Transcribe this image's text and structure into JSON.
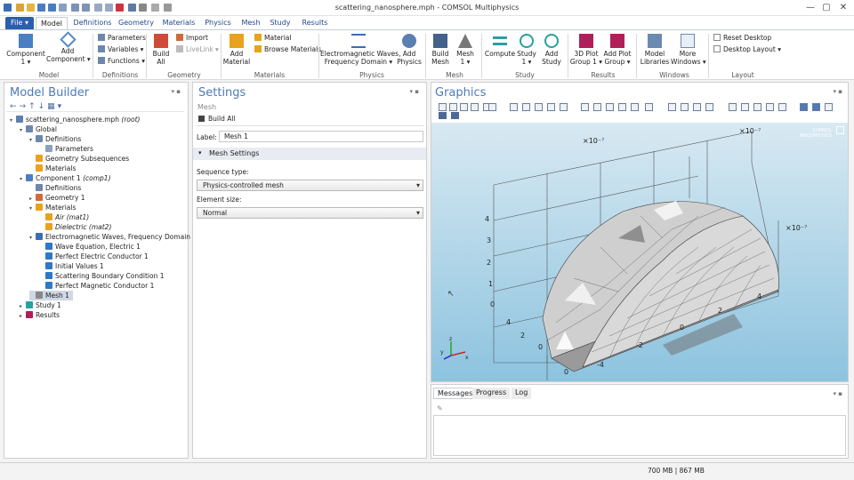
{
  "window": {
    "title": "scattering_nanosphere.mph - COMSOL Multiphysics"
  },
  "tabs": {
    "file": "File ▾",
    "model": "Model",
    "definitions": "Definitions",
    "geometry": "Geometry",
    "materials": "Materials",
    "physics": "Physics",
    "mesh": "Mesh",
    "study": "Study",
    "results": "Results"
  },
  "ribbon": {
    "component": "Component\n1 ▾",
    "add_component": "Add\nComponent ▾",
    "parameters": "Parameters",
    "variables": "Variables ▾",
    "functions": "Functions ▾",
    "build_all": "Build\nAll",
    "import": "Import",
    "livelink": "LiveLink ▾",
    "add_material": "Add\nMaterial",
    "material": "Material",
    "browse_materials": "Browse Materials",
    "em_waves": "Electromagnetic Waves,\nFrequency Domain ▾",
    "add_physics": "Add\nPhysics",
    "build_mesh": "Build\nMesh",
    "mesh1": "Mesh\n1 ▾",
    "compute": "Compute",
    "study1": "Study\n1 ▾",
    "add_study": "Add\nStudy",
    "plot3d": "3D Plot\nGroup 1 ▾",
    "add_plot": "Add Plot\nGroup ▾",
    "model_libraries": "Model\nLibraries",
    "more_windows": "More\nWindows ▾",
    "reset_desktop": "Reset Desktop",
    "desktop_layout": "Desktop Layout ▾",
    "groups": {
      "model": "Model",
      "definitions": "Definitions",
      "geometry": "Geometry",
      "materials": "Materials",
      "physics": "Physics",
      "mesh": "Mesh",
      "study": "Study",
      "results": "Results",
      "windows": "Windows",
      "layout": "Layout"
    }
  },
  "model_builder": {
    "title": "Model Builder",
    "tree": [
      {
        "label": "scattering_nanosphere.mph",
        "suffix": "(root)",
        "depth": 0
      },
      {
        "label": "Global",
        "depth": 1
      },
      {
        "label": "Definitions",
        "depth": 2
      },
      {
        "label": "Parameters",
        "depth": 3
      },
      {
        "label": "Geometry Subsequences",
        "depth": 2
      },
      {
        "label": "Materials",
        "depth": 2
      },
      {
        "label": "Component 1",
        "suffix": "(comp1)",
        "depth": 1
      },
      {
        "label": "Definitions",
        "depth": 2
      },
      {
        "label": "Geometry 1",
        "depth": 2
      },
      {
        "label": "Materials",
        "depth": 2
      },
      {
        "label": "Air",
        "suffix": "(mat1)",
        "depth": 3
      },
      {
        "label": "Dielectric",
        "suffix": "(mat2)",
        "depth": 3
      },
      {
        "label": "Electromagnetic Waves, Frequency Domain",
        "suffix": "(e",
        "depth": 2
      },
      {
        "label": "Wave Equation, Electric 1",
        "depth": 3
      },
      {
        "label": "Perfect Electric Conductor 1",
        "depth": 3
      },
      {
        "label": "Initial Values 1",
        "depth": 3
      },
      {
        "label": "Scattering Boundary Condition 1",
        "depth": 3
      },
      {
        "label": "Perfect Magnetic Conductor 1",
        "depth": 3
      },
      {
        "label": "Mesh 1",
        "depth": 2
      },
      {
        "label": "Study 1",
        "depth": 1
      },
      {
        "label": "Results",
        "depth": 1
      }
    ]
  },
  "settings": {
    "title": "Settings",
    "subtitle": "Mesh",
    "build_all": "Build All",
    "label_caption": "Label:",
    "label_value": "Mesh 1",
    "section": "Mesh Settings",
    "sequence_type_label": "Sequence type:",
    "sequence_type_value": "Physics-controlled mesh",
    "element_size_label": "Element size:",
    "element_size_value": "Normal"
  },
  "graphics": {
    "title": "Graphics",
    "exp_left": "×10⁻⁷",
    "exp_top": "×10⁻⁷",
    "exp_right": "×10⁻⁷",
    "watermark": "COMSOL\nMULTIPHYSICS",
    "z_ticks": [
      "4",
      "3",
      "2",
      "1",
      "0"
    ],
    "x_ticks": [
      "4",
      "2",
      "0"
    ],
    "y_ticks": [
      "4",
      "2",
      "0",
      "-2",
      "-4"
    ],
    "front_ticks": [
      "0"
    ]
  },
  "messages": {
    "tabs": [
      "Messages",
      "Progress",
      "Log"
    ]
  },
  "status": {
    "memory": "700 MB | 867 MB"
  },
  "colors": {
    "accent": "#2b5fae",
    "header_blue": "#4d7ab8",
    "graphics_bg_top": "#d5e7f1",
    "graphics_bg_bottom": "#8ec4e0"
  }
}
